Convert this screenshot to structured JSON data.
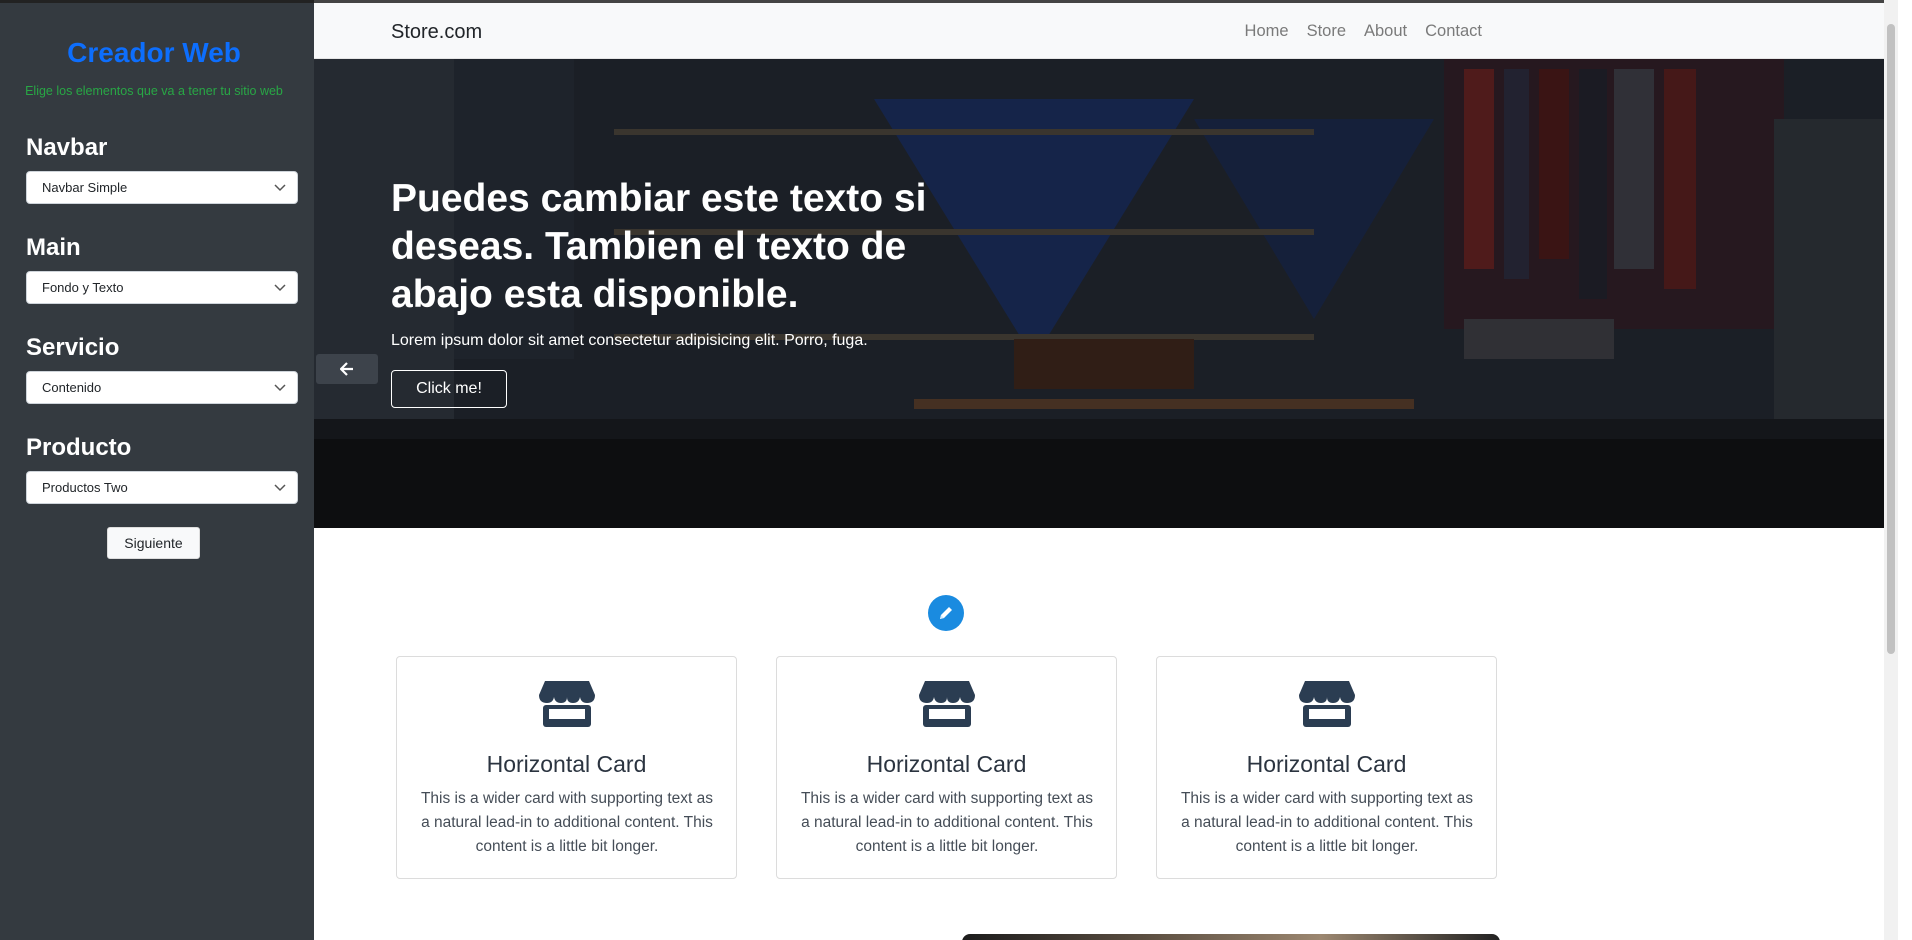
{
  "sidebar": {
    "title": "Creador Web",
    "subtitle": "Elige los elementos que va a tener tu sitio web",
    "sections": [
      {
        "label": "Navbar",
        "selected": "Navbar Simple"
      },
      {
        "label": "Main",
        "selected": "Fondo y Texto"
      },
      {
        "label": "Servicio",
        "selected": "Contenido"
      },
      {
        "label": "Producto",
        "selected": "Productos Two"
      }
    ],
    "next_button": "Siguiente"
  },
  "navbar": {
    "brand": "Store.com",
    "links": [
      "Home",
      "Store",
      "About",
      "Contact"
    ]
  },
  "hero": {
    "title": "Puedes cambiar este texto si deseas. Tambien el texto de abajo esta disponible.",
    "text": "Lorem ipsum dolor sit amet consectetur adipisicing elit. Porro, fuga.",
    "button": "Click me!"
  },
  "cards": [
    {
      "title": "Horizontal Card",
      "text": "This is a wider card with supporting text as a natural lead-in to additional content. This content is a little bit longer."
    },
    {
      "title": "Horizontal Card",
      "text": "This is a wider card with supporting text as a natural lead-in to additional content. This content is a little bit longer."
    },
    {
      "title": "Horizontal Card",
      "text": "This is a wider card with supporting text as a natural lead-in to additional content. This content is a little bit longer."
    }
  ],
  "icons": {
    "back": "arrow-left-icon",
    "edit": "pencil-icon",
    "card": "store-icon",
    "select": "chevron-down-icon"
  },
  "colors": {
    "sidebar_bg": "#343a40",
    "title_blue": "#0d6efd",
    "subtitle_green": "#28a745",
    "edit_blue": "#1a8be0"
  }
}
